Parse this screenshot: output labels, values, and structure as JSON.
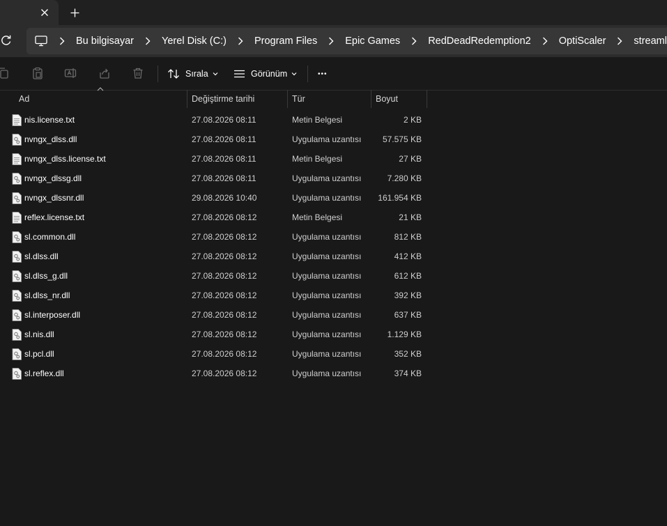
{
  "titlebar": {
    "close_glyph": "✕",
    "new_tab_glyph": "+"
  },
  "breadcrumb": [
    "Bu bilgisayar",
    "Yerel Disk (C:)",
    "Program Files",
    "Epic Games",
    "RedDeadRedemption2",
    "OptiScaler",
    "streamline"
  ],
  "toolbar": {
    "sort_label": "Sırala",
    "view_label": "Görünüm",
    "more_glyph": "•••"
  },
  "columns": {
    "name": "Ad",
    "date": "Değiştirme tarihi",
    "type": "Tür",
    "size": "Boyut"
  },
  "files": [
    {
      "name": "nis.license.txt",
      "date": "27.08.2026 08:11",
      "type": "Metin Belgesi",
      "size": "2 KB",
      "icon": "text-file-icon"
    },
    {
      "name": "nvngx_dlss.dll",
      "date": "27.08.2026 08:11",
      "type": "Uygulama uzantısı",
      "size": "57.575 KB",
      "icon": "dll-file-icon"
    },
    {
      "name": "nvngx_dlss.license.txt",
      "date": "27.08.2026 08:11",
      "type": "Metin Belgesi",
      "size": "27 KB",
      "icon": "text-file-icon"
    },
    {
      "name": "nvngx_dlssg.dll",
      "date": "27.08.2026 08:11",
      "type": "Uygulama uzantısı",
      "size": "7.280 KB",
      "icon": "dll-file-icon"
    },
    {
      "name": "nvngx_dlssnr.dll",
      "date": "29.08.2026 10:40",
      "type": "Uygulama uzantısı",
      "size": "161.954 KB",
      "icon": "dll-file-icon"
    },
    {
      "name": "reflex.license.txt",
      "date": "27.08.2026 08:12",
      "type": "Metin Belgesi",
      "size": "21 KB",
      "icon": "text-file-icon"
    },
    {
      "name": "sl.common.dll",
      "date": "27.08.2026 08:12",
      "type": "Uygulama uzantısı",
      "size": "812 KB",
      "icon": "dll-file-icon"
    },
    {
      "name": "sl.dlss.dll",
      "date": "27.08.2026 08:12",
      "type": "Uygulama uzantısı",
      "size": "412 KB",
      "icon": "dll-file-icon"
    },
    {
      "name": "sl.dlss_g.dll",
      "date": "27.08.2026 08:12",
      "type": "Uygulama uzantısı",
      "size": "612 KB",
      "icon": "dll-file-icon"
    },
    {
      "name": "sl.dlss_nr.dll",
      "date": "27.08.2026 08:12",
      "type": "Uygulama uzantısı",
      "size": "392 KB",
      "icon": "dll-file-icon"
    },
    {
      "name": "sl.interposer.dll",
      "date": "27.08.2026 08:12",
      "type": "Uygulama uzantısı",
      "size": "637 KB",
      "icon": "dll-file-icon"
    },
    {
      "name": "sl.nis.dll",
      "date": "27.08.2026 08:12",
      "type": "Uygulama uzantısı",
      "size": "1.129 KB",
      "icon": "dll-file-icon"
    },
    {
      "name": "sl.pcl.dll",
      "date": "27.08.2026 08:12",
      "type": "Uygulama uzantısı",
      "size": "352 KB",
      "icon": "dll-file-icon"
    },
    {
      "name": "sl.reflex.dll",
      "date": "27.08.2026 08:12",
      "type": "Uygulama uzantısı",
      "size": "374 KB",
      "icon": "dll-file-icon"
    }
  ],
  "colors": {
    "background": "#191919",
    "titlebar": "#202020",
    "chrome": "#2c2c2c",
    "address": "#373737"
  }
}
